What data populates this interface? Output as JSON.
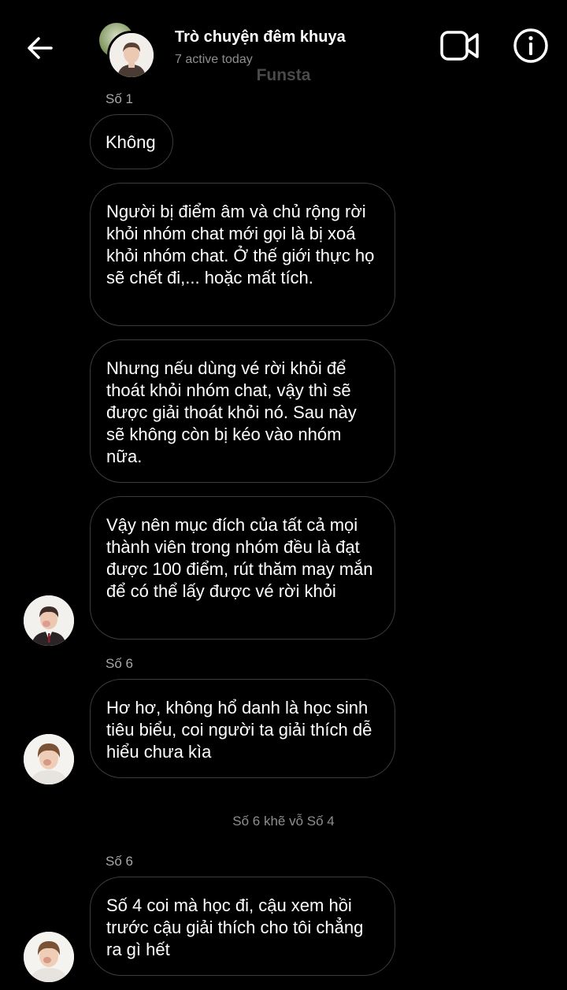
{
  "header": {
    "title": "Trò chuyện đêm khuya",
    "subtitle": "7 active today",
    "watermark": "Funsta"
  },
  "icons": {
    "back": "arrow-left-icon",
    "video": "video-camera-icon",
    "info": "info-circle-icon"
  },
  "messages": [
    {
      "sender": "Số 1",
      "bubbles": [
        "Không",
        "Người bị điểm âm và chủ rộng rời khỏi nhóm chat mới gọi là bị xoá khỏi nhóm chat. Ở thế giới thực họ sẽ chết đi,... hoặc mất tích.",
        "Nhưng nếu dùng vé rời khỏi để thoát khỏi nhóm chat, vậy thì sẽ được giải thoát khỏi nó. Sau này sẽ không còn bị kéo vào nhóm nữa.",
        "Vậy nên mục đích của tất cả mọi thành viên trong nhóm đều là đạt được 100 điểm, rút thăm may mắn để có thể lấy được vé rời khỏi"
      ]
    },
    {
      "sender": "Số 6",
      "bubbles": [
        "Hơ hơ, không hổ danh là học sinh tiêu biểu, coi người ta giải thích dễ hiểu chưa kìa"
      ]
    },
    {
      "system": "Số 6 khẽ vỗ Số 4"
    },
    {
      "sender": "Số 6",
      "bubbles": [
        "Số 4 coi mà học đi, cậu xem hồi trước cậu giải thích cho tôi chẳng ra gì hết"
      ]
    }
  ],
  "colors": {
    "background": "#000000",
    "bubble_border": "#3c3c3c",
    "secondary_text": "#8e8e8e"
  }
}
